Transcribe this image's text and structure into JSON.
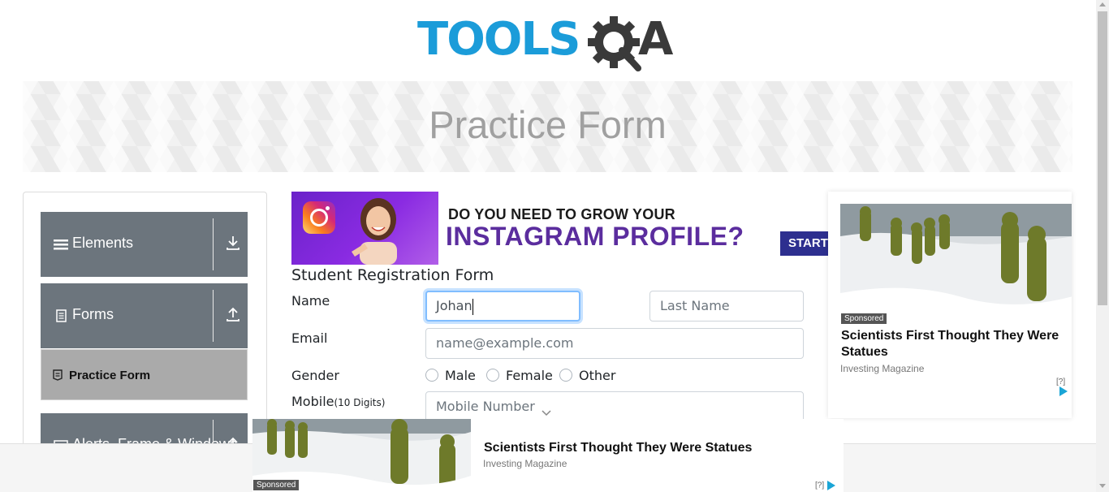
{
  "header": {
    "logo_text_main": "TOOLS",
    "logo_text_tail": "A",
    "logo_colors": {
      "main": "#1b9cd9",
      "dark": "#3a3a3a"
    }
  },
  "banner": {
    "title": "Practice Form"
  },
  "sidebar": {
    "groups": [
      {
        "label": "Elements",
        "icon": "hamburger-icon",
        "arrow": "download-arrow-icon"
      },
      {
        "label": "Forms",
        "icon": "document-icon",
        "arrow": "upload-arrow-icon",
        "items": [
          {
            "label": "Practice Form",
            "icon": "form-icon",
            "active": true
          }
        ]
      },
      {
        "label": "Alerts, Frame & Windows",
        "icon": "window-icon",
        "arrow": "upload-arrow-icon"
      }
    ],
    "colors": {
      "group_bg": "#6c757d",
      "active_item_bg": "#aaaaaa"
    }
  },
  "instagram_ad": {
    "line1": "DO YOU NEED TO GROW YOUR",
    "line2": "INSTAGRAM PROFILE?",
    "cta": "START"
  },
  "form": {
    "title": "Student Registration Form",
    "name_label": "Name",
    "first_name_value": "Johan",
    "last_name_placeholder": "Last Name",
    "email_label": "Email",
    "email_placeholder": "name@example.com",
    "gender_label": "Gender",
    "gender_options": [
      "Male",
      "Female",
      "Other"
    ],
    "mobile_label": "Mobile",
    "mobile_hint": "(10 Digits)",
    "mobile_placeholder": "Mobile Number"
  },
  "right_ad": {
    "sponsored": "Sponsored",
    "headline": "Scientists First Thought They Were Statues",
    "source": "Investing Magazine",
    "adchoice": "[?]"
  },
  "bottom_ad": {
    "sponsored": "Sponsored",
    "headline": "Scientists First Thought They Were Statues",
    "source": "Investing Magazine",
    "adchoice": "[?]"
  }
}
